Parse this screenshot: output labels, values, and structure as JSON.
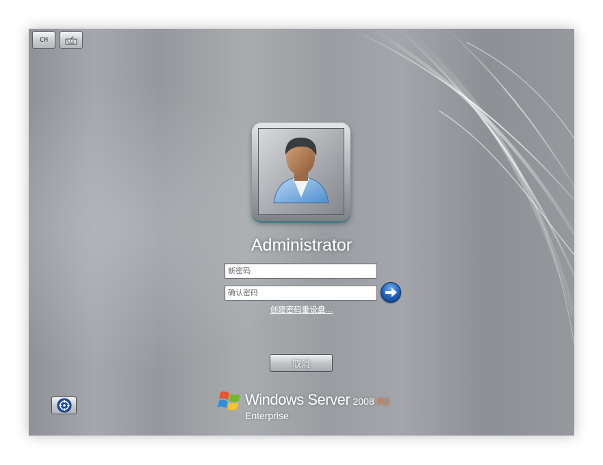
{
  "toolbar": {
    "language_label": "CH",
    "keyboard_icon": "keyboard-icon"
  },
  "user": {
    "name": "Administrator",
    "avatar_icon": "user-avatar-icon"
  },
  "form": {
    "new_password_placeholder": "新密码",
    "confirm_password_placeholder": "确认密码",
    "submit_icon": "arrow-right-icon",
    "reset_disk_link": "创建密码重设盘..."
  },
  "actions": {
    "cancel_label": "取消",
    "ease_of_access_icon": "ease-of-access-icon"
  },
  "branding": {
    "product": "Windows Server",
    "version": "2008",
    "release": "R2",
    "edition": "Enterprise",
    "logo_icon": "windows-flag-icon"
  },
  "colors": {
    "accent_blue": "#1e5fb8",
    "release_orange": "#e8743b"
  }
}
